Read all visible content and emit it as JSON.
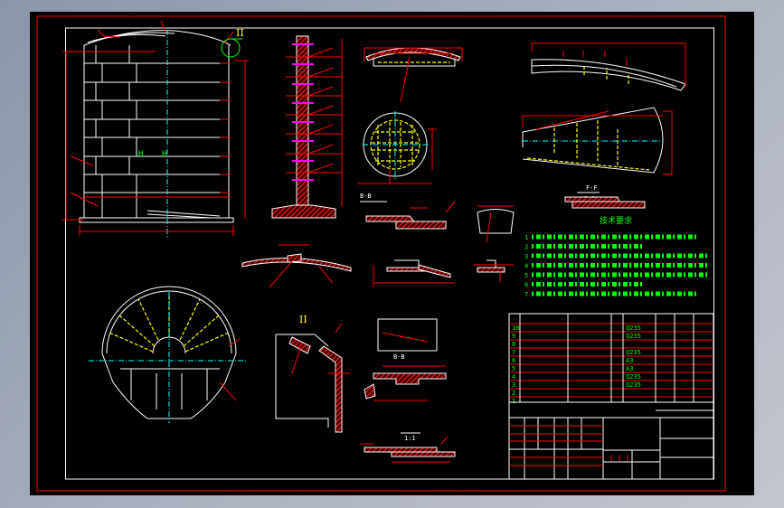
{
  "colors": {
    "background": "#000000",
    "frame_outer": "#ff0000",
    "frame_inner": "#ffffff",
    "dimension": "#ff0000",
    "text": "#00ff00",
    "hidden": "#ffff00",
    "centerline": "#00ffff",
    "weld": "#ff00ff"
  },
  "views": {
    "detail_ii_marker": "II",
    "detail_ii_title": "II",
    "section_ff": "F-F",
    "section_ff_scale": "1:1",
    "section_bb": "B-B",
    "section_bb_small": "B-B",
    "section_ee_scale": "1:1",
    "front_label_h": "H",
    "notes_title": "技术要求"
  },
  "parts_table": {
    "rows": [
      {
        "no": "10",
        "material": "Q235"
      },
      {
        "no": "9",
        "material": "Q235"
      },
      {
        "no": "8",
        "material": ""
      },
      {
        "no": "7",
        "material": "Q235"
      },
      {
        "no": "6",
        "material": "A3"
      },
      {
        "no": "5",
        "material": "A3"
      },
      {
        "no": "4",
        "material": "Q235"
      },
      {
        "no": "3",
        "material": "Q235"
      },
      {
        "no": "2",
        "material": ""
      },
      {
        "no": "1",
        "material": ""
      }
    ]
  },
  "notes": {
    "items": [
      "1",
      "2",
      "3",
      "4",
      "5",
      "6",
      "7"
    ]
  }
}
